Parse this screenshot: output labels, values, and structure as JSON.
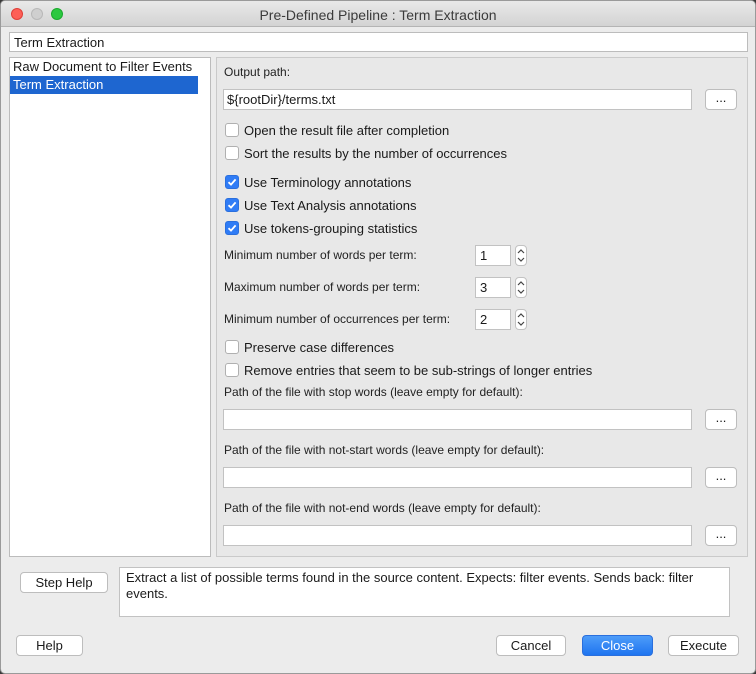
{
  "window": {
    "title": "Pre-Defined Pipeline : Term Extraction"
  },
  "pipeline_name": "Term Extraction",
  "steps": [
    {
      "label": "Raw Document to Filter Events",
      "selected": false
    },
    {
      "label": "Term Extraction",
      "selected": true
    }
  ],
  "params": {
    "output_path_label": "Output path:",
    "output_path_value": "${rootDir}/terms.txt",
    "browse_label": "...",
    "checkboxes": [
      {
        "label": "Open the result file after completion",
        "checked": false
      },
      {
        "label": "Sort the results by the number of occurrences",
        "checked": false
      },
      {
        "label": "Use Terminology annotations",
        "checked": true
      },
      {
        "label": "Use Text Analysis annotations",
        "checked": true
      },
      {
        "label": "Use tokens-grouping statistics",
        "checked": true
      },
      {
        "label": "Preserve case differences",
        "checked": false
      },
      {
        "label": "Remove entries that seem to be sub-strings of longer entries",
        "checked": false
      }
    ],
    "min_words_label": "Minimum number of words per term:",
    "min_words_value": "1",
    "max_words_label": "Maximum number of words per term:",
    "max_words_value": "3",
    "min_occ_label": "Minimum number of occurrences per term:",
    "min_occ_value": "2",
    "stop_words_label": "Path of the file with stop words (leave empty for default):",
    "stop_words_value": "",
    "not_start_label": "Path of the file with not-start words (leave empty for default):",
    "not_start_value": "",
    "not_end_label": "Path of the file with not-end words (leave empty for default):",
    "not_end_value": ""
  },
  "step_help_label": "Step Help",
  "description": "Extract a list of possible terms found in the source content. Expects: filter events. Sends back: filter events.",
  "buttons": {
    "help": "Help",
    "cancel": "Cancel",
    "close": "Close",
    "execute": "Execute"
  },
  "colors": {
    "accent": "#1e66d0",
    "checkbox_checked": "#2f7cf6",
    "primary_button": "#1f75f0"
  }
}
